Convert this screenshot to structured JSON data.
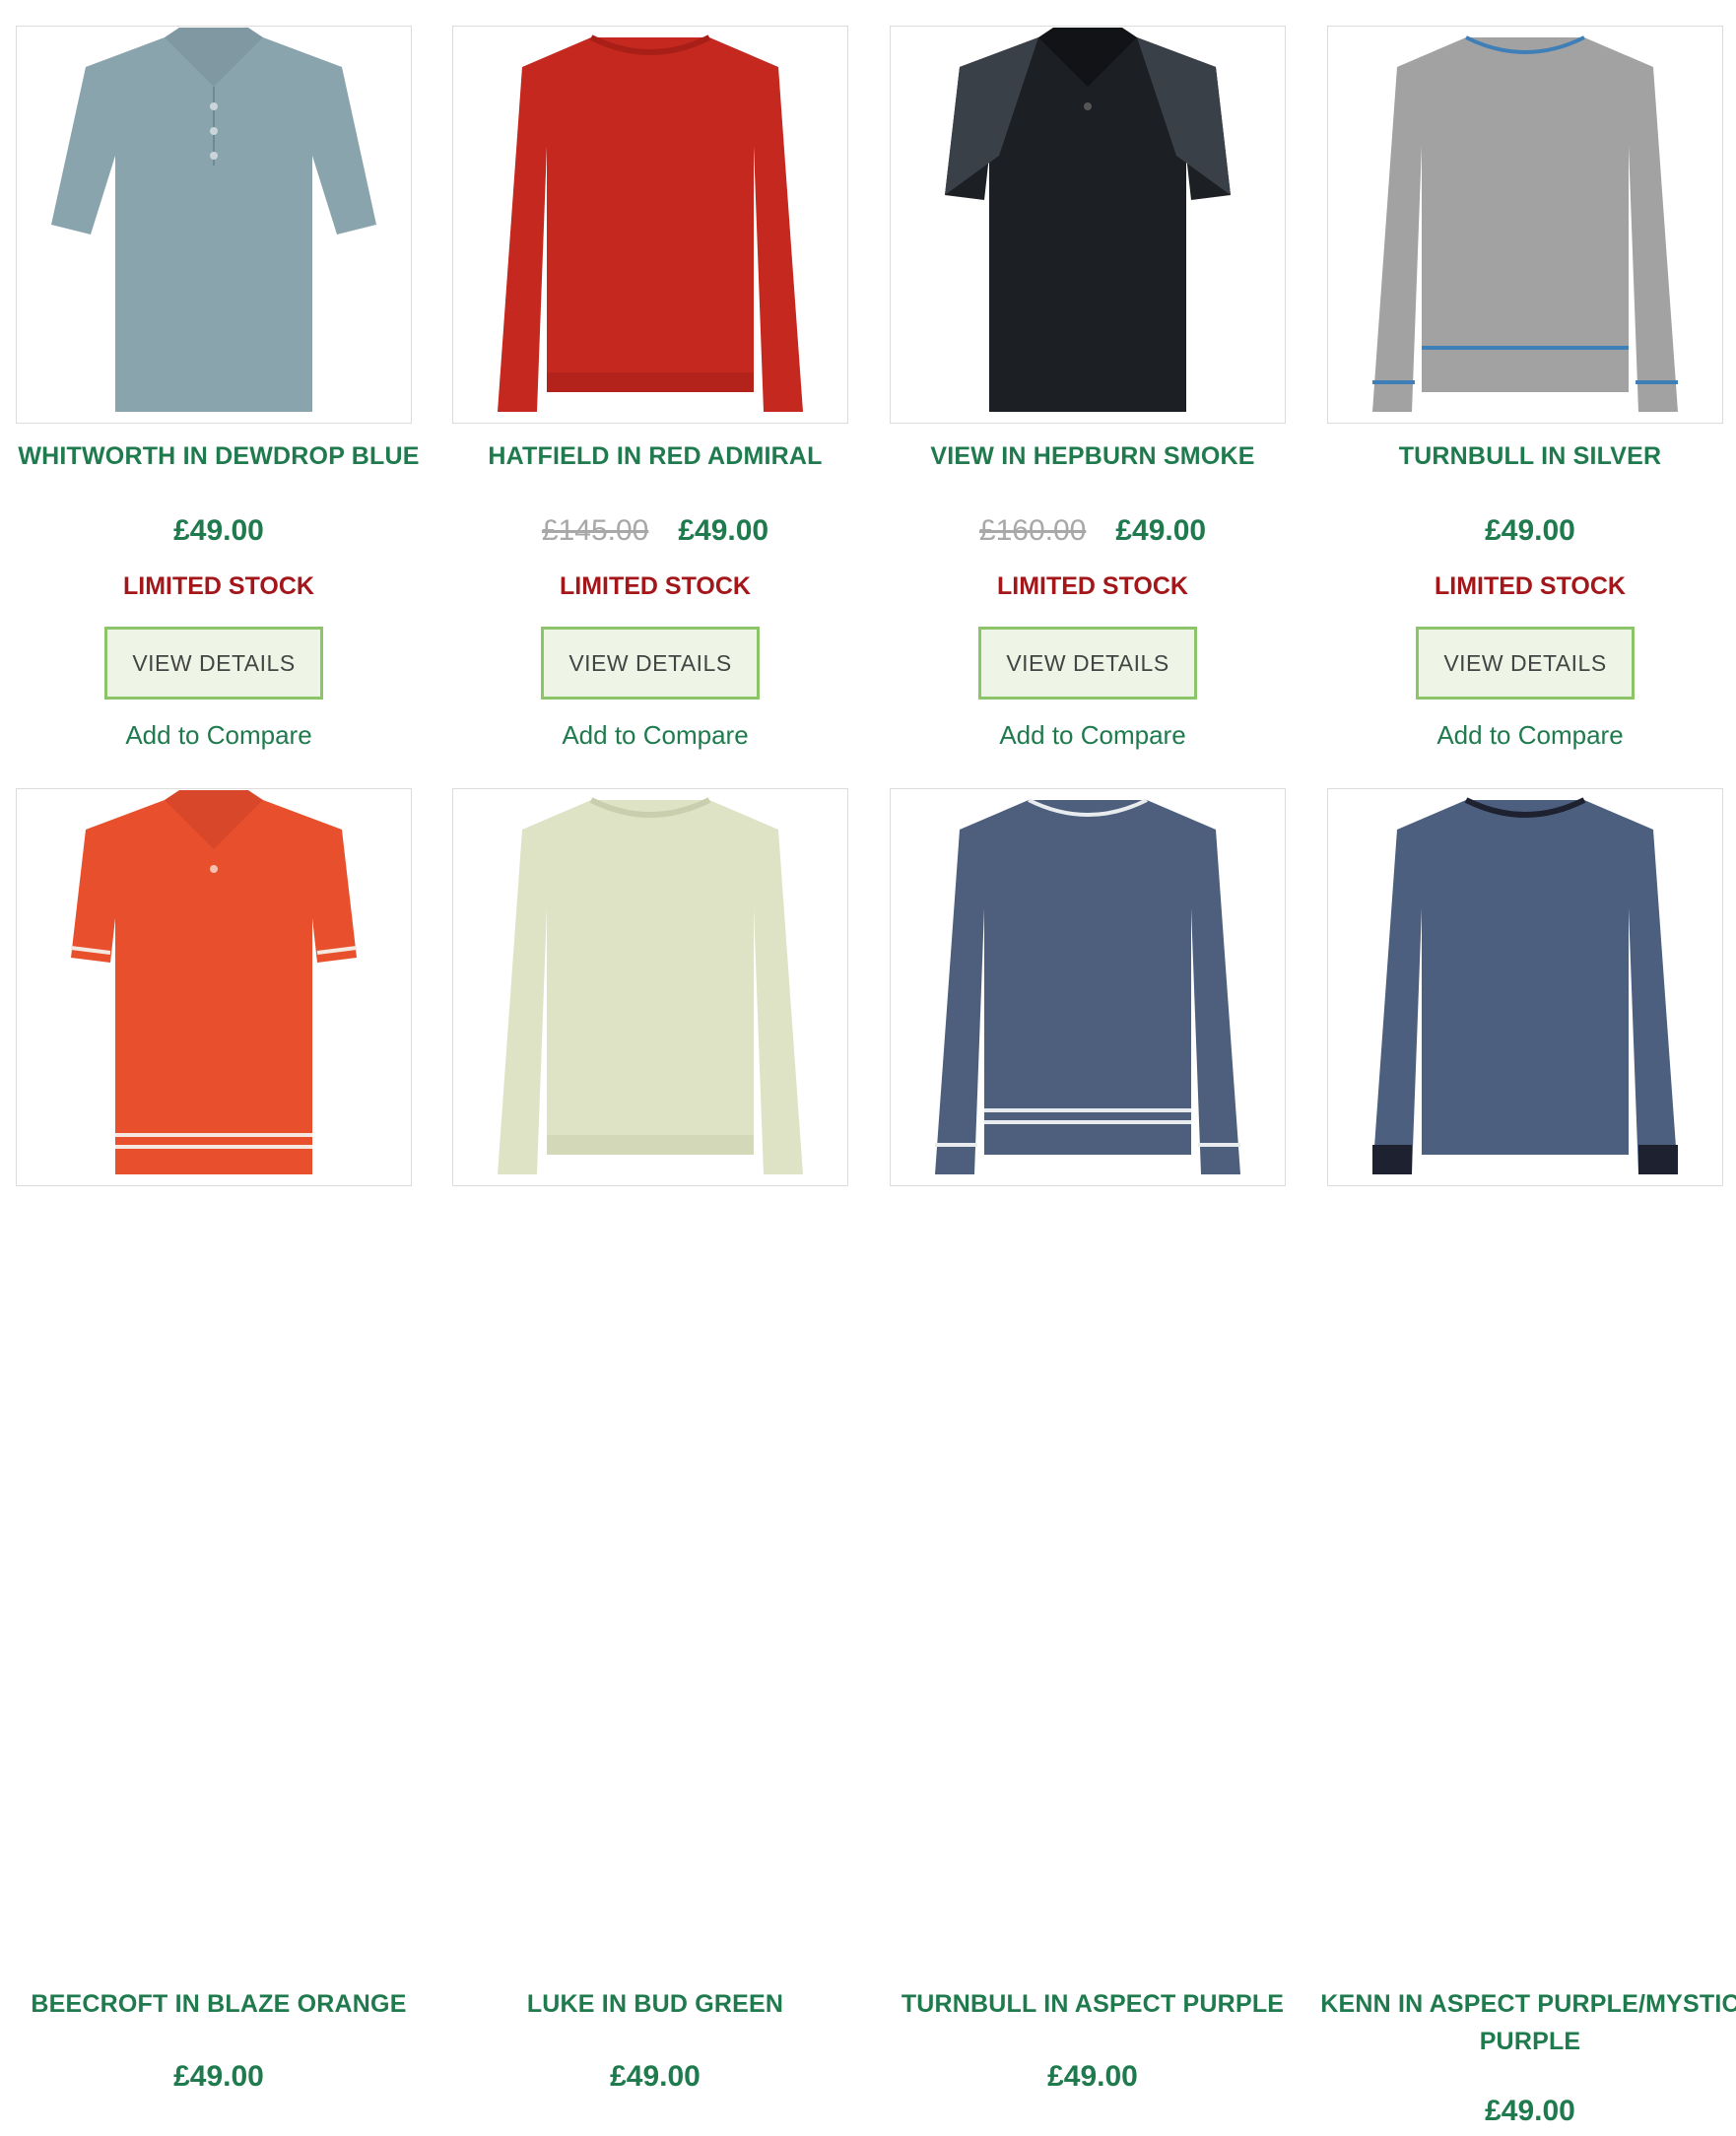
{
  "products": [
    {
      "name": "WHITWORTH IN DEWDROP BLUE",
      "old_price": "",
      "price": "£49.00",
      "stock": "LIMITED STOCK",
      "button": "VIEW DETAILS",
      "compare": "Add to Compare",
      "garment": "polo-shirt-icon",
      "color": "#8aa4ad"
    },
    {
      "name": "HATFIELD IN RED ADMIRAL",
      "old_price": "£145.00",
      "price": "£49.00",
      "stock": "LIMITED STOCK",
      "button": "VIEW DETAILS",
      "compare": "Add to Compare",
      "garment": "sweater-icon",
      "color": "#c4281f"
    },
    {
      "name": "VIEW IN HEPBURN SMOKE",
      "old_price": "£160.00",
      "price": "£49.00",
      "stock": "LIMITED STOCK",
      "button": "VIEW DETAILS",
      "compare": "Add to Compare",
      "garment": "polo-shirt-icon",
      "color": "#1c1f24"
    },
    {
      "name": "TURNBULL IN SILVER",
      "old_price": "",
      "price": "£49.00",
      "stock": "LIMITED STOCK",
      "button": "VIEW DETAILS",
      "compare": "Add to Compare",
      "garment": "sweater-icon",
      "color": "#a2a2a2"
    },
    {
      "name": "BEECROFT IN BLAZE ORANGE",
      "old_price": "",
      "price": "£49.00",
      "garment": "polo-shirt-icon",
      "color": "#e8502d"
    },
    {
      "name": "LUKE IN BUD GREEN",
      "old_price": "",
      "price": "£49.00",
      "garment": "sweater-icon",
      "color": "#dfe3c6"
    },
    {
      "name": "TURNBULL IN ASPECT PURPLE",
      "old_price": "",
      "price": "£49.00",
      "garment": "sweater-icon",
      "color": "#4e5f7e"
    },
    {
      "name": "KENN IN ASPECT PURPLE/MYSTIC PURPLE",
      "old_price": "",
      "price": "£49.00",
      "garment": "sweater-icon",
      "color": "#4d5f7f"
    }
  ],
  "colors": {
    "brand_green": "#1f7a4d",
    "stock_red": "#a3161a",
    "button_border": "#8cc46a",
    "button_bg": "#eef5e6"
  }
}
